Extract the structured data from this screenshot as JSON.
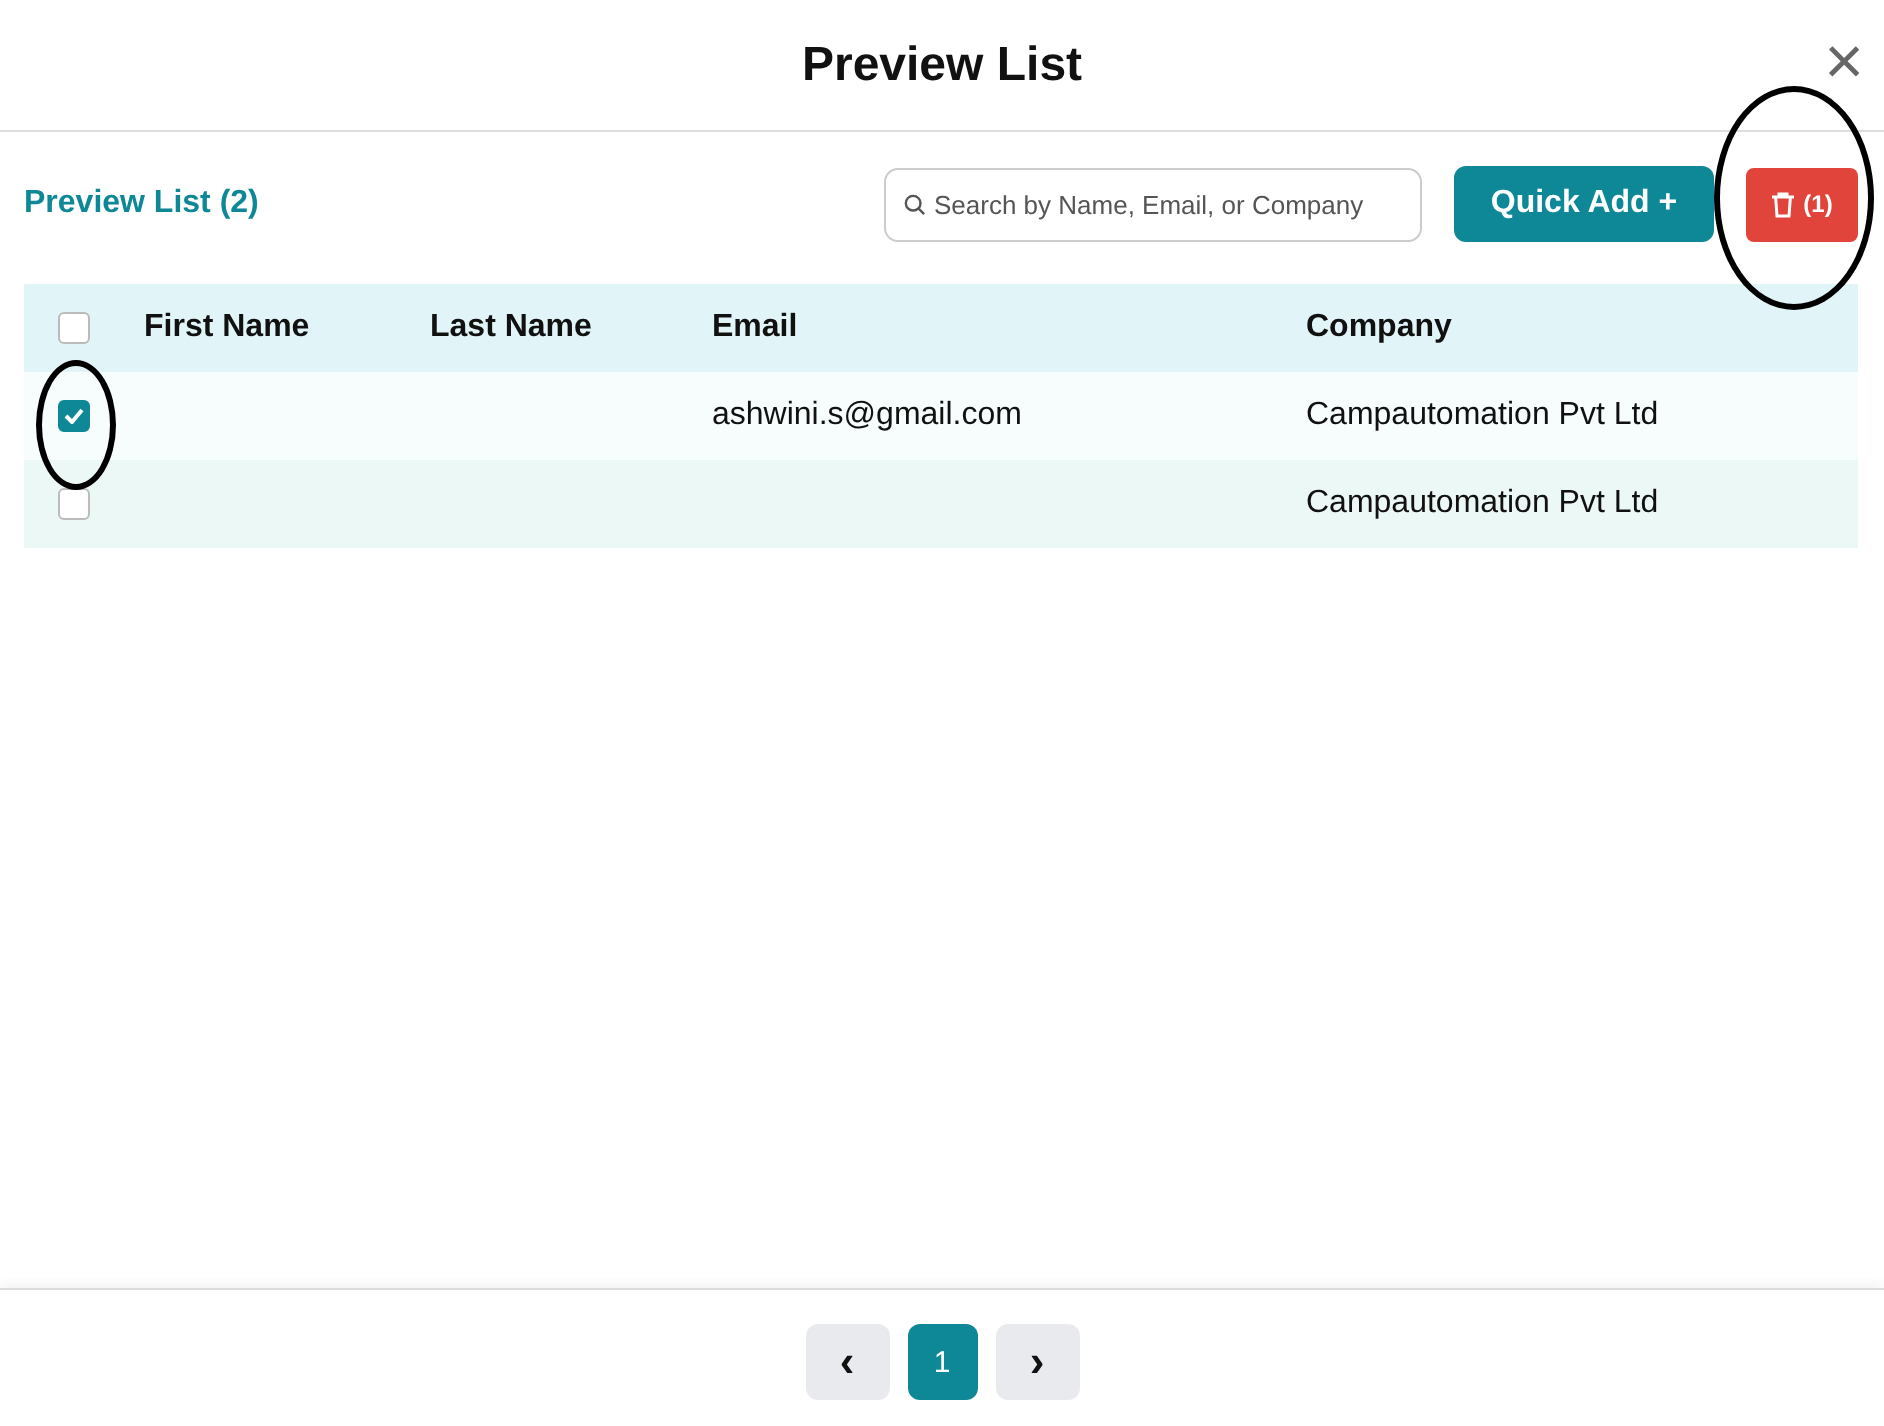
{
  "dialog": {
    "title": "Preview List",
    "close_icon": "×"
  },
  "toolbar": {
    "list_label": "Preview List (2)",
    "search": {
      "placeholder": "Search by Name, Email, or Company"
    },
    "quick_add": "Quick Add +",
    "delete_count": "(1)"
  },
  "table": {
    "select_all": {
      "checked": false
    },
    "columns": [
      "First Name",
      "Last Name",
      "Email",
      "Company"
    ],
    "rows": [
      {
        "checked": true,
        "cells": [
          "",
          "",
          "ashwini.s@gmail.com",
          "Campautomation Pvt Ltd"
        ]
      },
      {
        "checked": false,
        "cells": [
          "",
          "",
          "",
          "Campautomation Pvt Ltd"
        ]
      }
    ]
  },
  "pagination": {
    "prev": "‹",
    "pages": [
      {
        "label": "1",
        "selected": true
      }
    ],
    "next": "›"
  },
  "annotations": [
    {
      "kind": "ellipse"
    },
    {
      "kind": "ellipse"
    }
  ]
}
